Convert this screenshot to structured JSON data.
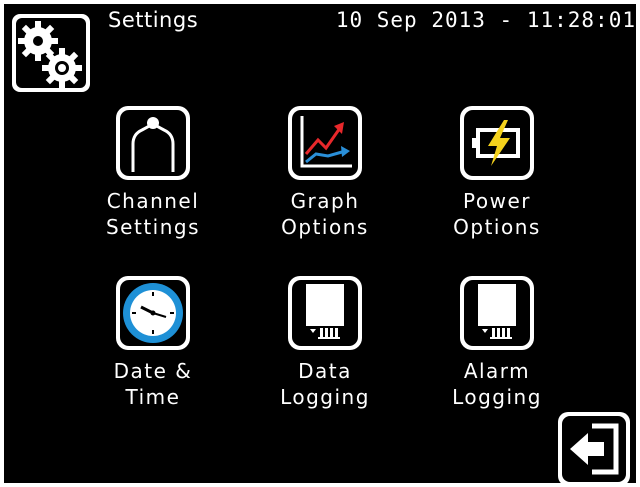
{
  "header": {
    "title": "Settings",
    "datetime": "10 Sep 2013 - 11:28:01",
    "icon": "gears-icon"
  },
  "tiles": [
    {
      "label": "Channel\nSettings",
      "icon": "thermocouple-probe-icon"
    },
    {
      "label": "Graph\nOptions",
      "icon": "graph-trend-icon"
    },
    {
      "label": "Power\nOptions",
      "icon": "battery-charging-icon"
    },
    {
      "label": "Date &\nTime",
      "icon": "clock-icon"
    },
    {
      "label": "Data\nLogging",
      "icon": "sd-card-icon"
    },
    {
      "label": "Alarm\nLogging",
      "icon": "sd-card-icon"
    }
  ],
  "exit": {
    "icon": "exit-icon"
  },
  "colors": {
    "background": "#000000",
    "foreground": "#ffffff",
    "graph_red": "#e8282b",
    "graph_blue": "#2a8fd8",
    "battery_yellow": "#f5d21c",
    "clock_blue": "#1e90d6"
  }
}
